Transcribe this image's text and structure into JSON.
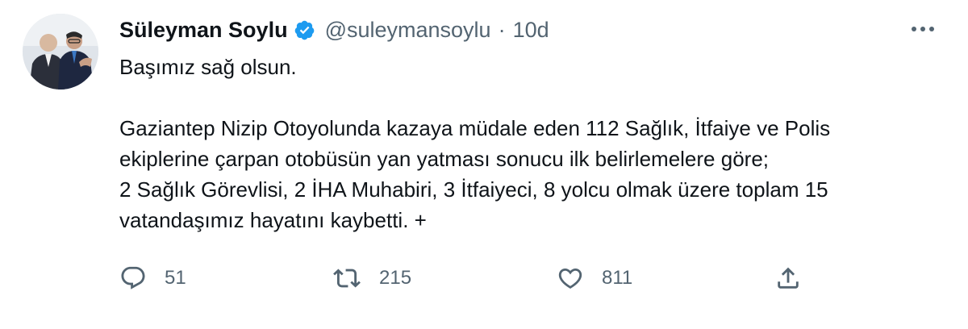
{
  "tweet": {
    "author_name": "Süleyman Soylu",
    "handle": "@suleymansoylu",
    "separator": "·",
    "time": "10d",
    "text_lines": [
      "Başımız sağ olsun.",
      "",
      "Gaziantep Nizip Otoyolunda kazaya müdale eden 112 Sağlık, İtfaiye ve Polis",
      "ekiplerine çarpan otobüsün yan yatması sonucu ilk belirlemelere göre;",
      "2 Sağlık Görevlisi, 2 İHA Muhabiri, 3 İtfaiyeci, 8 yolcu olmak üzere toplam 15",
      "vatandaşımız hayatını kaybetti. +"
    ]
  },
  "actions": {
    "reply": {
      "icon": "reply-icon",
      "count": "51"
    },
    "retweet": {
      "icon": "retweet-icon",
      "count": "215"
    },
    "like": {
      "icon": "heart-icon",
      "count": "811"
    },
    "share": {
      "icon": "share-icon"
    }
  },
  "icons": {
    "verified": "verified-badge-icon",
    "more": "more-options-icon"
  },
  "colors": {
    "text": "#0f1419",
    "secondary": "#536471",
    "verified": "#1d9bf0",
    "background": "#ffffff"
  }
}
